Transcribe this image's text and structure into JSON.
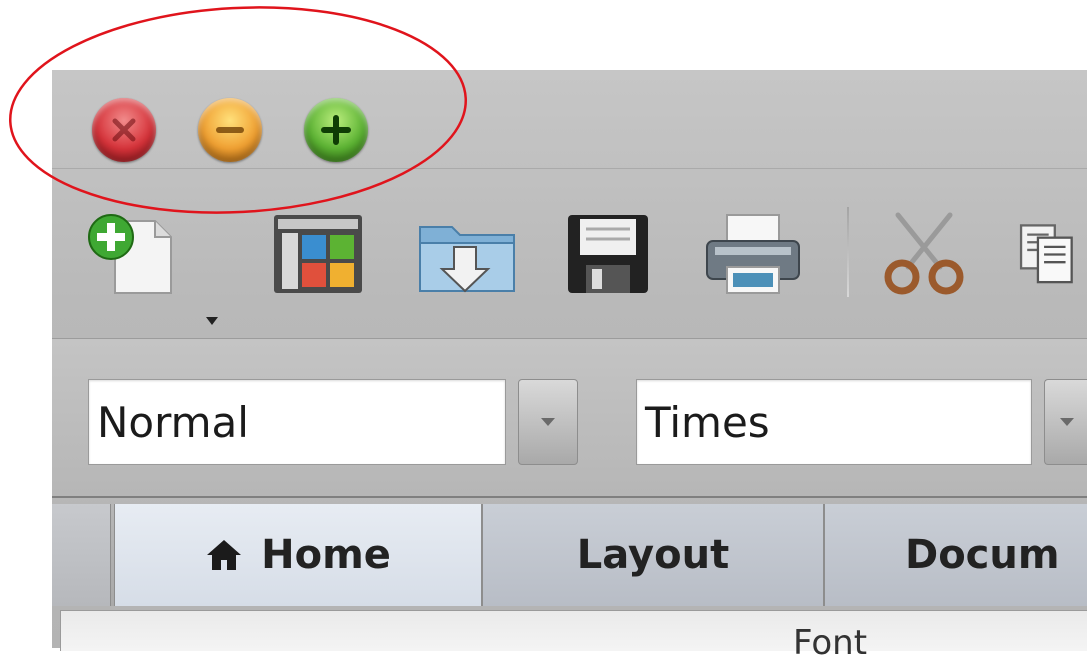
{
  "window_controls": {
    "close": "close-button",
    "minimize": "minimize-button",
    "zoom": "zoom-button"
  },
  "toolbar": {
    "icons": [
      "new-document-icon",
      "gallery-icon",
      "open-folder-icon",
      "save-icon",
      "print-icon",
      "cut-icon",
      "copy-icon"
    ]
  },
  "formatting": {
    "style_value": "Normal",
    "font_value": "Times"
  },
  "tabs": {
    "home": "Home",
    "layout": "Layout",
    "document": "Docum"
  },
  "ribbon": {
    "group_title": "Font"
  },
  "colors": {
    "annotation": "#e0141c",
    "close": "#d6333a",
    "minimize": "#f0a032",
    "zoom": "#5cb333"
  }
}
